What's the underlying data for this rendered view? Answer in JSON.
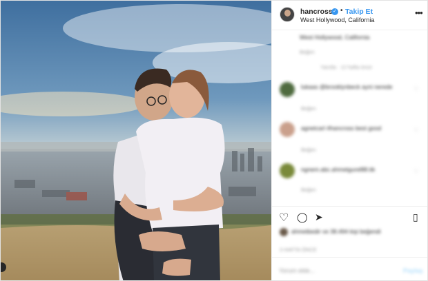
{
  "header": {
    "username": "hancross",
    "separator": "•",
    "follow_label": "Takip Et",
    "location": "West Hollywood, California",
    "more": "•••"
  },
  "comments": [
    {
      "text": "West Hollywood, California",
      "likes": "Beğen",
      "time": "Yanıtla · 12 hafta önce"
    },
    {
      "text": "lukaas @brooklynbeck ayni nerede",
      "likes": "Beğen",
      "time": ""
    },
    {
      "text": "agnetcarl #hancross best good",
      "likes": "Beğen",
      "time": ""
    },
    {
      "text": "ngnem.abc.ahmetgurellllll.tik",
      "likes": "Beğen",
      "time": ""
    }
  ],
  "likes_line": "ahmetbedir ve 38.494 kişi beğendi",
  "post_time": "3 HAFTA ÖNCE",
  "add_comment_placeholder": "Yorum ekle...",
  "post_button": "Paylaş",
  "icons": {
    "like": "heart-icon",
    "comment": "comment-icon",
    "share": "share-icon",
    "save": "bookmark-icon"
  }
}
